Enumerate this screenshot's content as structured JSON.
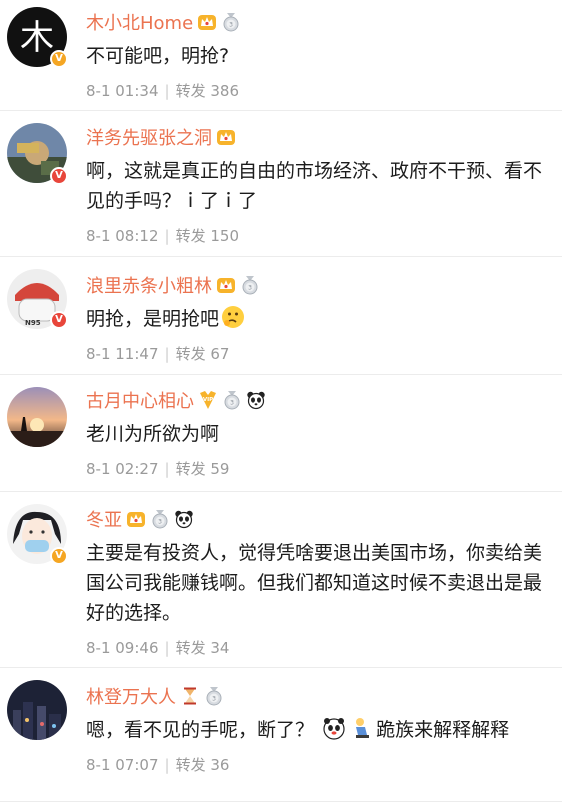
{
  "comments": [
    {
      "username": "木小北Home",
      "text": "不可能吧，明抢?",
      "date": "8-1 01:34",
      "repost_label": "转发",
      "repost_count": "386",
      "avatar_char": "木"
    },
    {
      "username": "洋务先驱张之洞",
      "text": "啊，这就是真正的自由的市场经济、政府不干预、看不见的手吗？ｉ了ｉ了",
      "date": "8-1 08:12",
      "repost_label": "转发",
      "repost_count": "150"
    },
    {
      "username": "浪里赤条小粗林",
      "text": "明抢，是明抢吧",
      "date": "8-1 11:47",
      "repost_label": "转发",
      "repost_count": "67",
      "avatar_text": "N95"
    },
    {
      "username": "古月中心相心",
      "text": "老川为所欲为啊",
      "date": "8-1 02:27",
      "repost_label": "转发",
      "repost_count": "59"
    },
    {
      "username": "冬亚",
      "text": "主要是有投资人，觉得凭啥要退出美国市场，你卖给美国公司我能赚钱啊。但我们都知道这时候不卖退出是最好的选择。",
      "date": "8-1 09:46",
      "repost_label": "转发",
      "repost_count": "34"
    },
    {
      "username": "林登万大人",
      "text_before": "嗯，看不见的手呢，断了？",
      "text_after": "跪族来解释解释",
      "date": "8-1 07:07",
      "repost_label": "转发",
      "repost_count": "36"
    }
  ],
  "badges": {
    "crown": "VIP crown",
    "medal": "medal",
    "panda": "panda",
    "hourglass": "hourglass",
    "vip": "VIP"
  },
  "colors": {
    "username": "#eb7350",
    "meta": "#9a9a9a",
    "verified_gold": "#f5a623",
    "verified_red": "#e8463b"
  }
}
